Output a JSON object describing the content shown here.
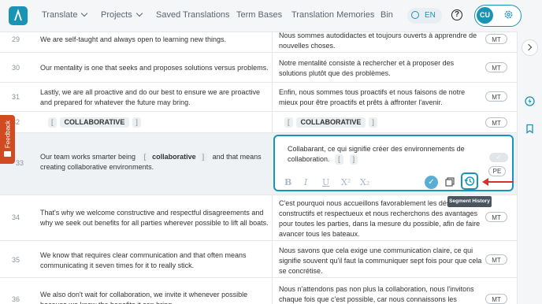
{
  "nav": {
    "translate": "Translate",
    "projects": "Projects",
    "saved_translations": "Saved Translations",
    "term_bases": "Term Bases",
    "translation_memories": "Translation Memories",
    "bin": "Bin",
    "language": "EN",
    "help": "?",
    "avatar_initials": "CU"
  },
  "feedback_label": "Feedback",
  "rows": [
    {
      "num": "29",
      "source": "We are self-taught and always open to learning new things.",
      "target": "Nous sommes autodidactes et toujours ouverts à apprendre de nouvelles choses.",
      "badge": "MT"
    },
    {
      "num": "30",
      "source": "Our mentality is one that seeks and proposes solutions versus problems.",
      "target": "Notre mentalité consiste à rechercher et à proposer des solutions plutôt que des problèmes.",
      "badge": "MT"
    },
    {
      "num": "31",
      "source": "Lastly, we are all proactive and do our best to ensure we are proactive and prepared for whatever the future may bring.",
      "target": "Enfin, nous sommes tous proactifs et nous faisons de notre mieux pour être proactifs et prêts à affronter l'avenir.",
      "badge": "MT"
    },
    {
      "num": "32",
      "source_tag": "COLLABORATIVE",
      "target_tag": "COLLABORATIVE",
      "badge": "MT"
    },
    {
      "num": "33",
      "source_pre": "Our team works smarter being",
      "source_tag": "collaborative",
      "source_post": "and that means creating collaborative environments.",
      "target": "Collabarant, ce qui signifie créer des environnements de collaboration.",
      "badge": "PE"
    },
    {
      "num": "34",
      "source": "That's why we welcome constructive and respectful disagreements and why we seek out benefits for all parties wherever possible to lift all boats.",
      "target": "C'est pourquoi nous accueillons favorablement les désaccords constructifs et respectueux et nous recherchons des avantages pour toutes les parties, dans la mesure du possible, afin de faire avancer tous les bateaux.",
      "badge": "MT"
    },
    {
      "num": "35",
      "source": "We know that requires clear communication and that often means communicating it seven times for it to really stick.",
      "target": "Nous savons que cela exige une communication claire, ce qui signifie souvent qu'il faut la communiquer sept fois pour que cela se concrétise.",
      "badge": "MT"
    },
    {
      "num": "36",
      "source": "We also don't wait for collaboration, we invite it whenever possible because we know the benefits it can bring.",
      "target": "Nous n'attendons pas non plus la collaboration, nous l'invitons chaque fois que c'est possible, car nous connaissons les",
      "badge": "MT"
    }
  ],
  "editor_tools": {
    "bold": "B",
    "italic": "I",
    "underline": "U",
    "superscript": "X²",
    "subscript": "X₂"
  },
  "tooltip": "Segment History",
  "colors": {
    "accent": "#1a94b5",
    "feedback": "#d04a22",
    "arrow": "#d9302a"
  }
}
